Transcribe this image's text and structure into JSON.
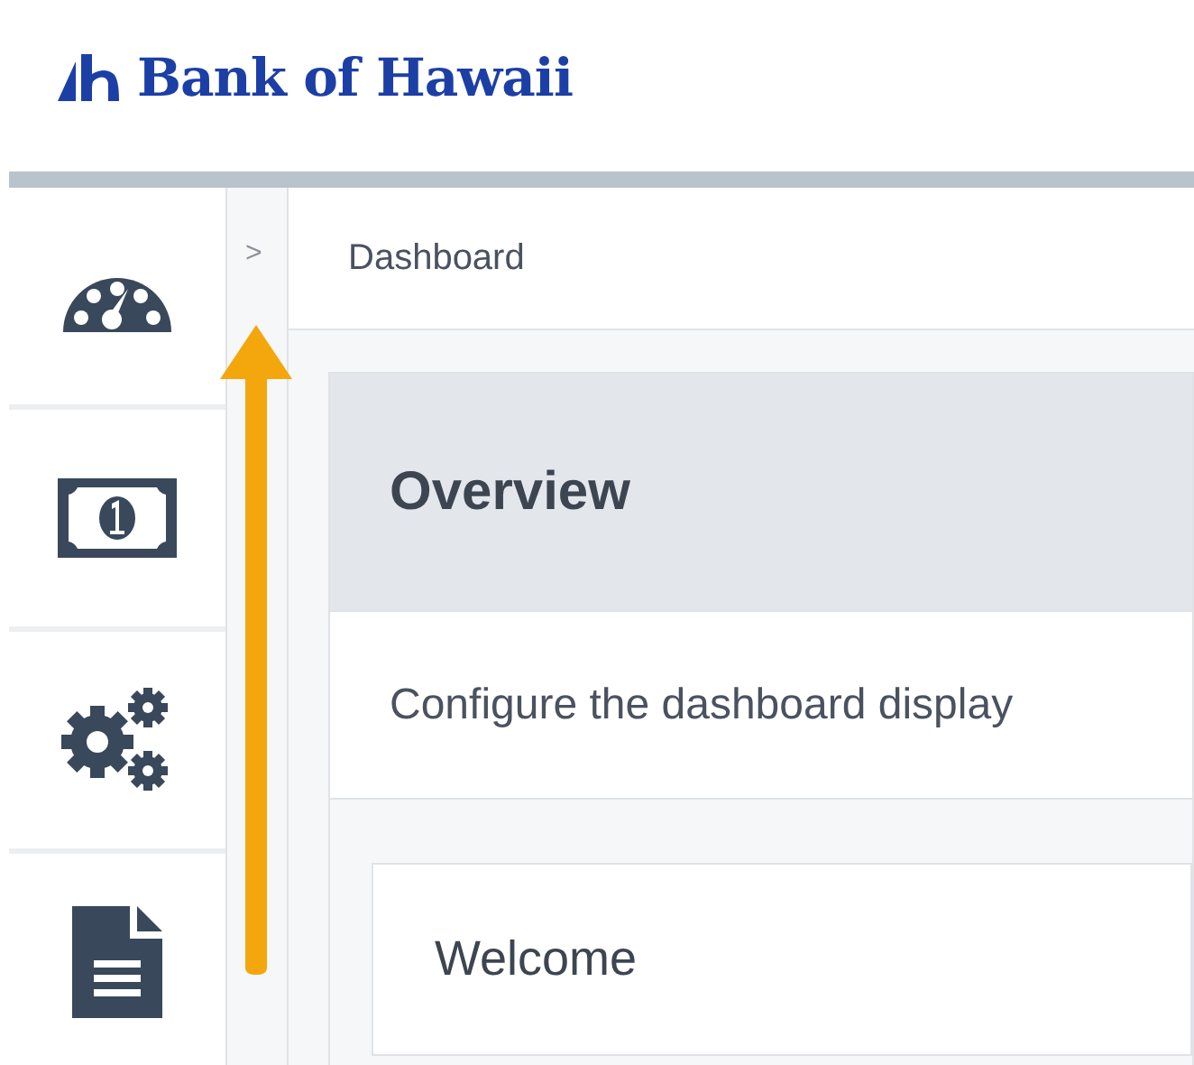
{
  "brand": {
    "name": "Bank of Hawaii"
  },
  "sidebar": {
    "items": [
      {
        "kind": "gauge"
      },
      {
        "kind": "money"
      },
      {
        "kind": "gears"
      },
      {
        "kind": "document"
      }
    ]
  },
  "expand_toggle": ">",
  "breadcrumb": "Dashboard",
  "panel": {
    "title": "Overview",
    "description": "Configure the dashboard display",
    "card": {
      "title": "Welcome"
    }
  }
}
